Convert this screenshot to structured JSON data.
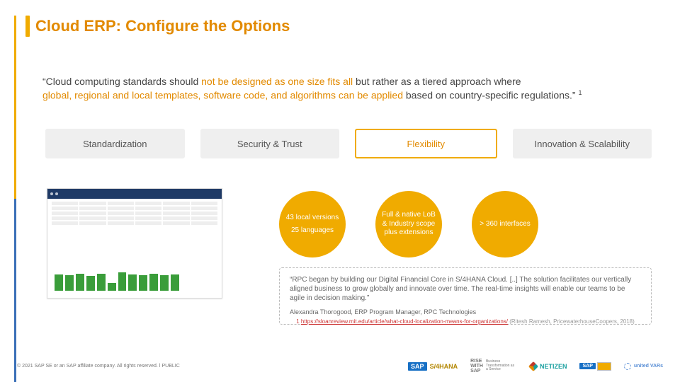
{
  "title": "Cloud ERP: Configure the Options",
  "quote": {
    "pre": "“Cloud computing standards should ",
    "accent1": "not be designed as one size fits all",
    "mid": " but rather as a tiered approach where ",
    "accent2": "global, regional and local templates, software code, and algorithms can be applied",
    "post": " based on country-specific regulations.” ",
    "sup": "1"
  },
  "tabs": [
    {
      "label": "Standardization",
      "active": false
    },
    {
      "label": "Security & Trust",
      "active": false
    },
    {
      "label": "Flexibility",
      "active": true
    },
    {
      "label": "Innovation & Scalability",
      "active": false
    }
  ],
  "circles": {
    "c1a": "43 local versions",
    "c1b": "25 languages",
    "c2": "Full & native LoB & Industry scope plus extensions",
    "c3": "> 360 interfaces"
  },
  "testimonial": {
    "body": "“RPC began by building our Digital Financial Core in S/4HANA Cloud. [..]             The solution facilitates our vertically aligned business to grow globally and innovate over time. The real-time insights will enable our teams to be agile in decision making.”",
    "attr": "Alexandra Thorogood, ERP Program Manager, RPC Technologies"
  },
  "citation": {
    "sup": "1",
    "link": "https://sloanreview.mit.edu/article/what-cloud-localization-means-for-organizations/",
    "tail": " (Ritesh Ramesh, PricewaterhouseCoopers, 2018)"
  },
  "footer": {
    "copyright": "©  2021 SAP SE or an SAP affiliate company. All rights reserved.  ǀ  PUBLIC"
  },
  "logos": {
    "sap": "SAP",
    "s4": "S/4HANA",
    "rise1": "RISE",
    "rise2": "WITH",
    "rise3": "SAP",
    "rise_sub": "Business Transformation as a Service",
    "netizen": "NETIZEN",
    "uvar": "united VARs"
  }
}
